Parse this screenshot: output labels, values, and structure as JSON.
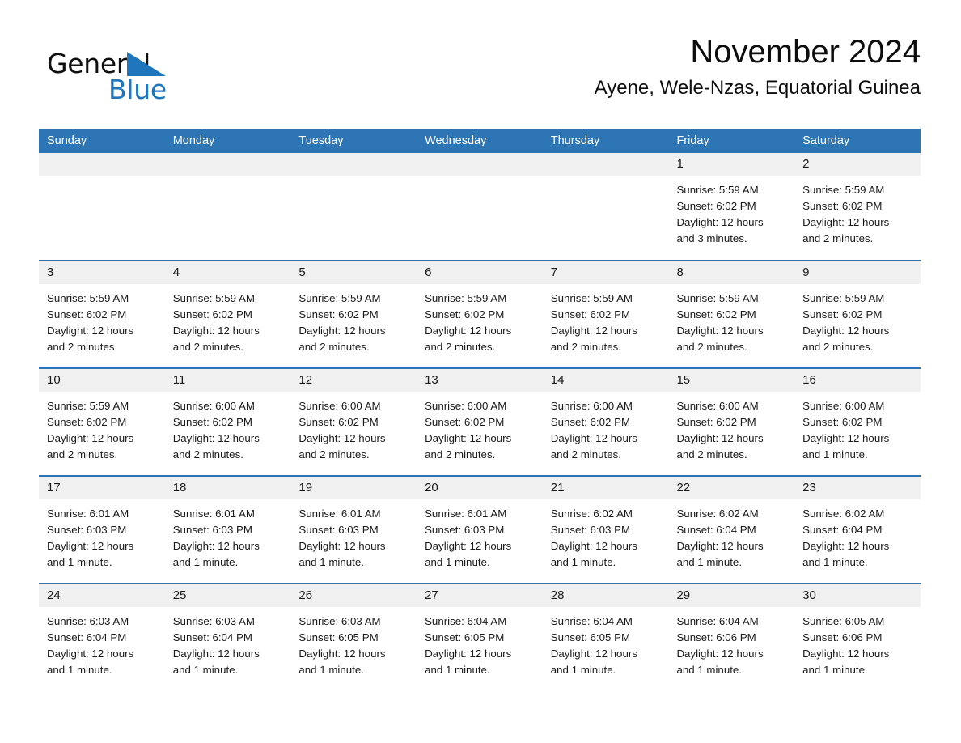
{
  "logo": {
    "text_top": "General",
    "text_bottom": "Blue",
    "triangle_icon": "triangle-icon",
    "color_black": "#0f0f0f",
    "color_blue": "#1f76bc"
  },
  "header": {
    "title": "November 2024",
    "subtitle": "Ayene, Wele-Nzas, Equatorial Guinea"
  },
  "colors": {
    "header_blue": "#2e75b6",
    "daynum_band": "#f0f0f0",
    "text": "#1a1a1a"
  },
  "weekday_headers": [
    "Sunday",
    "Monday",
    "Tuesday",
    "Wednesday",
    "Thursday",
    "Friday",
    "Saturday"
  ],
  "weeks": [
    [
      {
        "day": "",
        "empty": true,
        "sunrise": "",
        "sunset": "",
        "daylight_line1": "",
        "daylight_line2": ""
      },
      {
        "day": "",
        "empty": true,
        "sunrise": "",
        "sunset": "",
        "daylight_line1": "",
        "daylight_line2": ""
      },
      {
        "day": "",
        "empty": true,
        "sunrise": "",
        "sunset": "",
        "daylight_line1": "",
        "daylight_line2": ""
      },
      {
        "day": "",
        "empty": true,
        "sunrise": "",
        "sunset": "",
        "daylight_line1": "",
        "daylight_line2": ""
      },
      {
        "day": "",
        "empty": true,
        "sunrise": "",
        "sunset": "",
        "daylight_line1": "",
        "daylight_line2": ""
      },
      {
        "day": "1",
        "empty": false,
        "sunrise": "Sunrise: 5:59 AM",
        "sunset": "Sunset: 6:02 PM",
        "daylight_line1": "Daylight: 12 hours",
        "daylight_line2": "and 3 minutes."
      },
      {
        "day": "2",
        "empty": false,
        "sunrise": "Sunrise: 5:59 AM",
        "sunset": "Sunset: 6:02 PM",
        "daylight_line1": "Daylight: 12 hours",
        "daylight_line2": "and 2 minutes."
      }
    ],
    [
      {
        "day": "3",
        "empty": false,
        "sunrise": "Sunrise: 5:59 AM",
        "sunset": "Sunset: 6:02 PM",
        "daylight_line1": "Daylight: 12 hours",
        "daylight_line2": "and 2 minutes."
      },
      {
        "day": "4",
        "empty": false,
        "sunrise": "Sunrise: 5:59 AM",
        "sunset": "Sunset: 6:02 PM",
        "daylight_line1": "Daylight: 12 hours",
        "daylight_line2": "and 2 minutes."
      },
      {
        "day": "5",
        "empty": false,
        "sunrise": "Sunrise: 5:59 AM",
        "sunset": "Sunset: 6:02 PM",
        "daylight_line1": "Daylight: 12 hours",
        "daylight_line2": "and 2 minutes."
      },
      {
        "day": "6",
        "empty": false,
        "sunrise": "Sunrise: 5:59 AM",
        "sunset": "Sunset: 6:02 PM",
        "daylight_line1": "Daylight: 12 hours",
        "daylight_line2": "and 2 minutes."
      },
      {
        "day": "7",
        "empty": false,
        "sunrise": "Sunrise: 5:59 AM",
        "sunset": "Sunset: 6:02 PM",
        "daylight_line1": "Daylight: 12 hours",
        "daylight_line2": "and 2 minutes."
      },
      {
        "day": "8",
        "empty": false,
        "sunrise": "Sunrise: 5:59 AM",
        "sunset": "Sunset: 6:02 PM",
        "daylight_line1": "Daylight: 12 hours",
        "daylight_line2": "and 2 minutes."
      },
      {
        "day": "9",
        "empty": false,
        "sunrise": "Sunrise: 5:59 AM",
        "sunset": "Sunset: 6:02 PM",
        "daylight_line1": "Daylight: 12 hours",
        "daylight_line2": "and 2 minutes."
      }
    ],
    [
      {
        "day": "10",
        "empty": false,
        "sunrise": "Sunrise: 5:59 AM",
        "sunset": "Sunset: 6:02 PM",
        "daylight_line1": "Daylight: 12 hours",
        "daylight_line2": "and 2 minutes."
      },
      {
        "day": "11",
        "empty": false,
        "sunrise": "Sunrise: 6:00 AM",
        "sunset": "Sunset: 6:02 PM",
        "daylight_line1": "Daylight: 12 hours",
        "daylight_line2": "and 2 minutes."
      },
      {
        "day": "12",
        "empty": false,
        "sunrise": "Sunrise: 6:00 AM",
        "sunset": "Sunset: 6:02 PM",
        "daylight_line1": "Daylight: 12 hours",
        "daylight_line2": "and 2 minutes."
      },
      {
        "day": "13",
        "empty": false,
        "sunrise": "Sunrise: 6:00 AM",
        "sunset": "Sunset: 6:02 PM",
        "daylight_line1": "Daylight: 12 hours",
        "daylight_line2": "and 2 minutes."
      },
      {
        "day": "14",
        "empty": false,
        "sunrise": "Sunrise: 6:00 AM",
        "sunset": "Sunset: 6:02 PM",
        "daylight_line1": "Daylight: 12 hours",
        "daylight_line2": "and 2 minutes."
      },
      {
        "day": "15",
        "empty": false,
        "sunrise": "Sunrise: 6:00 AM",
        "sunset": "Sunset: 6:02 PM",
        "daylight_line1": "Daylight: 12 hours",
        "daylight_line2": "and 2 minutes."
      },
      {
        "day": "16",
        "empty": false,
        "sunrise": "Sunrise: 6:00 AM",
        "sunset": "Sunset: 6:02 PM",
        "daylight_line1": "Daylight: 12 hours",
        "daylight_line2": "and 1 minute."
      }
    ],
    [
      {
        "day": "17",
        "empty": false,
        "sunrise": "Sunrise: 6:01 AM",
        "sunset": "Sunset: 6:03 PM",
        "daylight_line1": "Daylight: 12 hours",
        "daylight_line2": "and 1 minute."
      },
      {
        "day": "18",
        "empty": false,
        "sunrise": "Sunrise: 6:01 AM",
        "sunset": "Sunset: 6:03 PM",
        "daylight_line1": "Daylight: 12 hours",
        "daylight_line2": "and 1 minute."
      },
      {
        "day": "19",
        "empty": false,
        "sunrise": "Sunrise: 6:01 AM",
        "sunset": "Sunset: 6:03 PM",
        "daylight_line1": "Daylight: 12 hours",
        "daylight_line2": "and 1 minute."
      },
      {
        "day": "20",
        "empty": false,
        "sunrise": "Sunrise: 6:01 AM",
        "sunset": "Sunset: 6:03 PM",
        "daylight_line1": "Daylight: 12 hours",
        "daylight_line2": "and 1 minute."
      },
      {
        "day": "21",
        "empty": false,
        "sunrise": "Sunrise: 6:02 AM",
        "sunset": "Sunset: 6:03 PM",
        "daylight_line1": "Daylight: 12 hours",
        "daylight_line2": "and 1 minute."
      },
      {
        "day": "22",
        "empty": false,
        "sunrise": "Sunrise: 6:02 AM",
        "sunset": "Sunset: 6:04 PM",
        "daylight_line1": "Daylight: 12 hours",
        "daylight_line2": "and 1 minute."
      },
      {
        "day": "23",
        "empty": false,
        "sunrise": "Sunrise: 6:02 AM",
        "sunset": "Sunset: 6:04 PM",
        "daylight_line1": "Daylight: 12 hours",
        "daylight_line2": "and 1 minute."
      }
    ],
    [
      {
        "day": "24",
        "empty": false,
        "sunrise": "Sunrise: 6:03 AM",
        "sunset": "Sunset: 6:04 PM",
        "daylight_line1": "Daylight: 12 hours",
        "daylight_line2": "and 1 minute."
      },
      {
        "day": "25",
        "empty": false,
        "sunrise": "Sunrise: 6:03 AM",
        "sunset": "Sunset: 6:04 PM",
        "daylight_line1": "Daylight: 12 hours",
        "daylight_line2": "and 1 minute."
      },
      {
        "day": "26",
        "empty": false,
        "sunrise": "Sunrise: 6:03 AM",
        "sunset": "Sunset: 6:05 PM",
        "daylight_line1": "Daylight: 12 hours",
        "daylight_line2": "and 1 minute."
      },
      {
        "day": "27",
        "empty": false,
        "sunrise": "Sunrise: 6:04 AM",
        "sunset": "Sunset: 6:05 PM",
        "daylight_line1": "Daylight: 12 hours",
        "daylight_line2": "and 1 minute."
      },
      {
        "day": "28",
        "empty": false,
        "sunrise": "Sunrise: 6:04 AM",
        "sunset": "Sunset: 6:05 PM",
        "daylight_line1": "Daylight: 12 hours",
        "daylight_line2": "and 1 minute."
      },
      {
        "day": "29",
        "empty": false,
        "sunrise": "Sunrise: 6:04 AM",
        "sunset": "Sunset: 6:06 PM",
        "daylight_line1": "Daylight: 12 hours",
        "daylight_line2": "and 1 minute."
      },
      {
        "day": "30",
        "empty": false,
        "sunrise": "Sunrise: 6:05 AM",
        "sunset": "Sunset: 6:06 PM",
        "daylight_line1": "Daylight: 12 hours",
        "daylight_line2": "and 1 minute."
      }
    ]
  ]
}
